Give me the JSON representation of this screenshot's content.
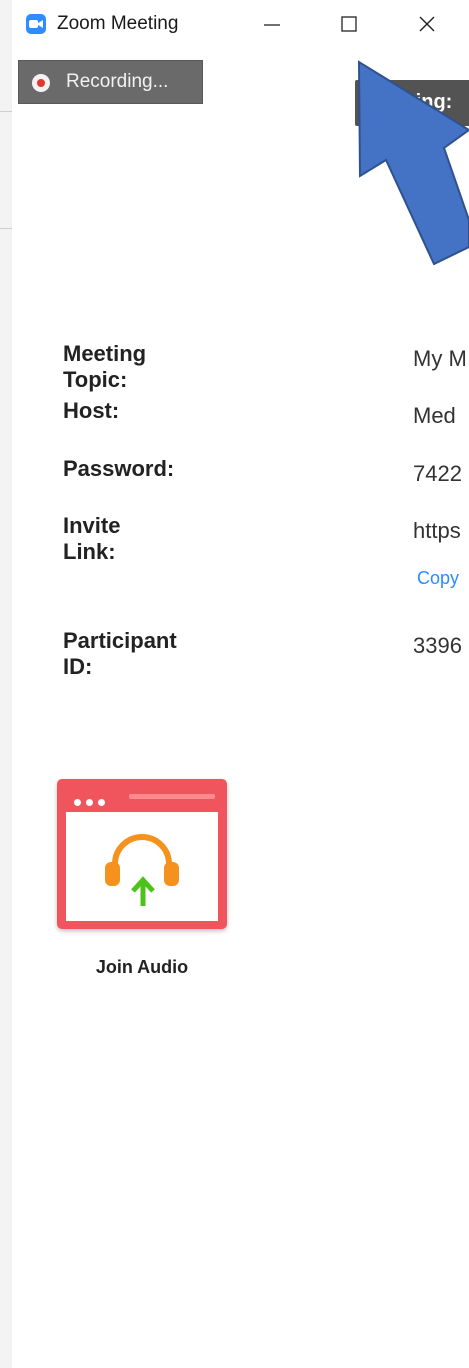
{
  "window": {
    "title": "Zoom Meeting",
    "icon": "zoom-camera-icon"
  },
  "recording": {
    "label": "Recording..."
  },
  "talking_badge": {
    "label": "lking:"
  },
  "meeting_info": {
    "rows": [
      {
        "label": "Meeting Topic:",
        "value": "My M"
      },
      {
        "label": "Host:",
        "value": "Med"
      },
      {
        "label": "Password:",
        "value": "7422"
      },
      {
        "label": "Invite Link:",
        "value": "https"
      },
      {
        "label": "Participant ID:",
        "value": "3396"
      }
    ],
    "copy_link_label": "Copy"
  },
  "join_audio": {
    "label": "Join Audio",
    "icon": "headphones-upload-icon"
  },
  "colors": {
    "zoom_blue": "#2d8cff",
    "tile_red": "#f0545c",
    "headphone_orange": "#f5921e",
    "arrow_green": "#4cc21a",
    "annotation_arrow": "#4472c4"
  }
}
